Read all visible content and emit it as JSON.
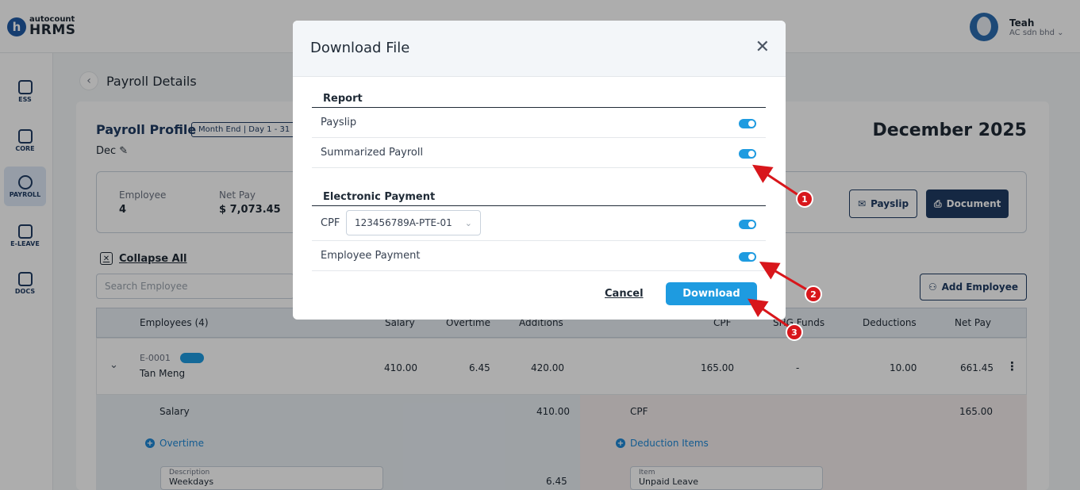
{
  "topbar": {
    "logo_small": "autocount",
    "logo_big": "HRMS",
    "logo_letter": "h",
    "user_name": "Teah",
    "user_company": "AC sdn bhd"
  },
  "sidenav": {
    "items": [
      {
        "label": "ESS",
        "icon": "badge-icon"
      },
      {
        "label": "CORE",
        "icon": "cube-icon"
      },
      {
        "label": "PAYROLL",
        "icon": "dollar-icon"
      },
      {
        "label": "E-LEAVE",
        "icon": "calendar-icon"
      },
      {
        "label": "DOCS",
        "icon": "document-icon"
      }
    ],
    "active_index": 2
  },
  "page": {
    "back_glyph": "‹",
    "title": "Payroll Details",
    "profile_title": "Payroll Profile",
    "period_badge": "Month End | Day 1 - 31",
    "dec_label": "Dec",
    "month_title": "December 2025",
    "summary": {
      "employee_label": "Employee",
      "employee_value": "4",
      "netpay_label": "Net Pay",
      "netpay_value": "$ 7,073.45"
    },
    "payslip_button": "Payslip",
    "document_button": "Document",
    "collapse_all": "Collapse All",
    "search_placeholder": "Search Employee",
    "add_employee": "Add Employee"
  },
  "table": {
    "headers": {
      "employees": "Employees (4)",
      "salary": "Salary",
      "overtime": "Overtime",
      "additions": "Additions",
      "cpf": "CPF",
      "shg_funds": "SHG Funds",
      "deductions": "Deductions",
      "net_pay": "Net Pay"
    },
    "row": {
      "code": "E-0001",
      "name": "Tan Meng",
      "salary": "410.00",
      "overtime": "6.45",
      "additions": "420.00",
      "cpf": "165.00",
      "shg": "-",
      "deductions": "10.00",
      "net_pay": "661.45"
    },
    "detail": {
      "salary_label": "Salary",
      "salary_value": "410.00",
      "overtime_link": "Overtime",
      "description_label": "Description",
      "description_value": "Weekdays",
      "overtime_value": "6.45",
      "cpf_label": "CPF",
      "cpf_value": "165.00",
      "deduction_link": "Deduction Items",
      "item_label": "Item",
      "item_value": "Unpaid Leave"
    }
  },
  "dialog": {
    "title": "Download File",
    "report_section": "Report",
    "payslip": "Payslip",
    "summarized_payroll": "Summarized Payroll",
    "electronic_section": "Electronic Payment",
    "cpf_label": "CPF",
    "cpf_value": "123456789A-PTE-01",
    "employee_payment": "Employee Payment",
    "cancel": "Cancel",
    "download": "Download",
    "toggles": {
      "payslip": true,
      "summarized_payroll": true,
      "cpf": true,
      "employee_payment": true
    }
  },
  "annotations": [
    "1",
    "2",
    "3"
  ],
  "colors": {
    "accent": "#1e9be0",
    "navy": "#1f3c63",
    "marker": "#d8161b"
  }
}
